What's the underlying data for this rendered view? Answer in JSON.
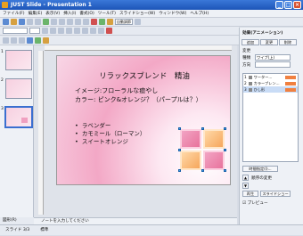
{
  "window": {
    "title": "JUST Slide - Presentation 1"
  },
  "menu": [
    "ファイル(F)",
    "編集(E)",
    "表示(V)",
    "挿入(I)",
    "書式(O)",
    "ツール(T)",
    "スライドショー(W)",
    "ウィンドウ(W)",
    "ヘルプ(H)"
  ],
  "toolbar": {
    "zoom": "自動調節"
  },
  "thumbnails": [
    {
      "num": "1"
    },
    {
      "num": "2"
    },
    {
      "num": "3"
    }
  ],
  "slide": {
    "title": "リラックスブレンド　精油",
    "line1": "イメージ:フローラルな癒やし",
    "line2": "カラー: ピンク&オレンジ？（パープルは？）",
    "bullets": [
      "ラベンダー",
      "カモミール（ローマン）",
      "スイートオレンジ"
    ]
  },
  "notes": {
    "placeholder": "ノートを入力してください"
  },
  "draw": {
    "label": "図形(R)"
  },
  "status": {
    "slide": "スライド 3/3",
    "layout": "標準"
  },
  "right": {
    "header": "効果(アニメーション)",
    "tab_add": "追加",
    "tab_change": "変更",
    "tab_remove": "削除",
    "section_change": "変更",
    "label_type": "種類",
    "type_value": "ワイプ(上)",
    "label_dir": "方向",
    "label_speed": "速度",
    "anim_items": [
      {
        "num": "1",
        "name": "ワーター..."
      },
      {
        "num": "2",
        "name": "カラーブレン..."
      },
      {
        "num": "3",
        "name": "ひし形"
      }
    ],
    "timing": "時間指定(I)...",
    "order_label": "順序の変更",
    "play": "再生",
    "slideshow": "スライドショー",
    "preview": "プレビュー"
  },
  "colors": {
    "accent": "#3a6fd0",
    "titlebar": "#1d55b8"
  }
}
